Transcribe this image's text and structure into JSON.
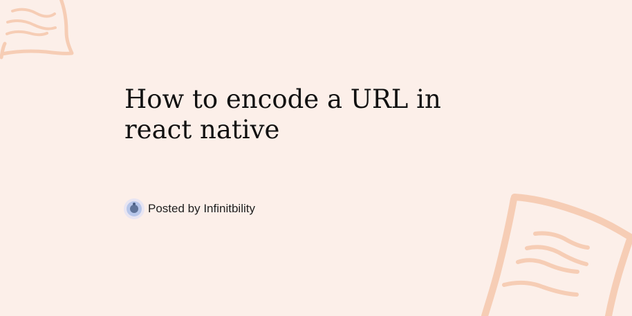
{
  "colors": {
    "background": "#fcefe9",
    "title_text": "#111111",
    "decoration": "#f6cdb5",
    "avatar_ring": "#e8e5f2",
    "avatar_fill": "#b8c7ea",
    "avatar_core": "#5f7399"
  },
  "header": {
    "title": "How to encode a URL in react native"
  },
  "author": {
    "posted_label": "Posted by Infinitbility",
    "avatar_icon": "avatar-icon"
  },
  "decorations": {
    "top_left_icon": "chat-bubble-doodle-icon",
    "bottom_right_icon": "paper-note-doodle-icon"
  }
}
